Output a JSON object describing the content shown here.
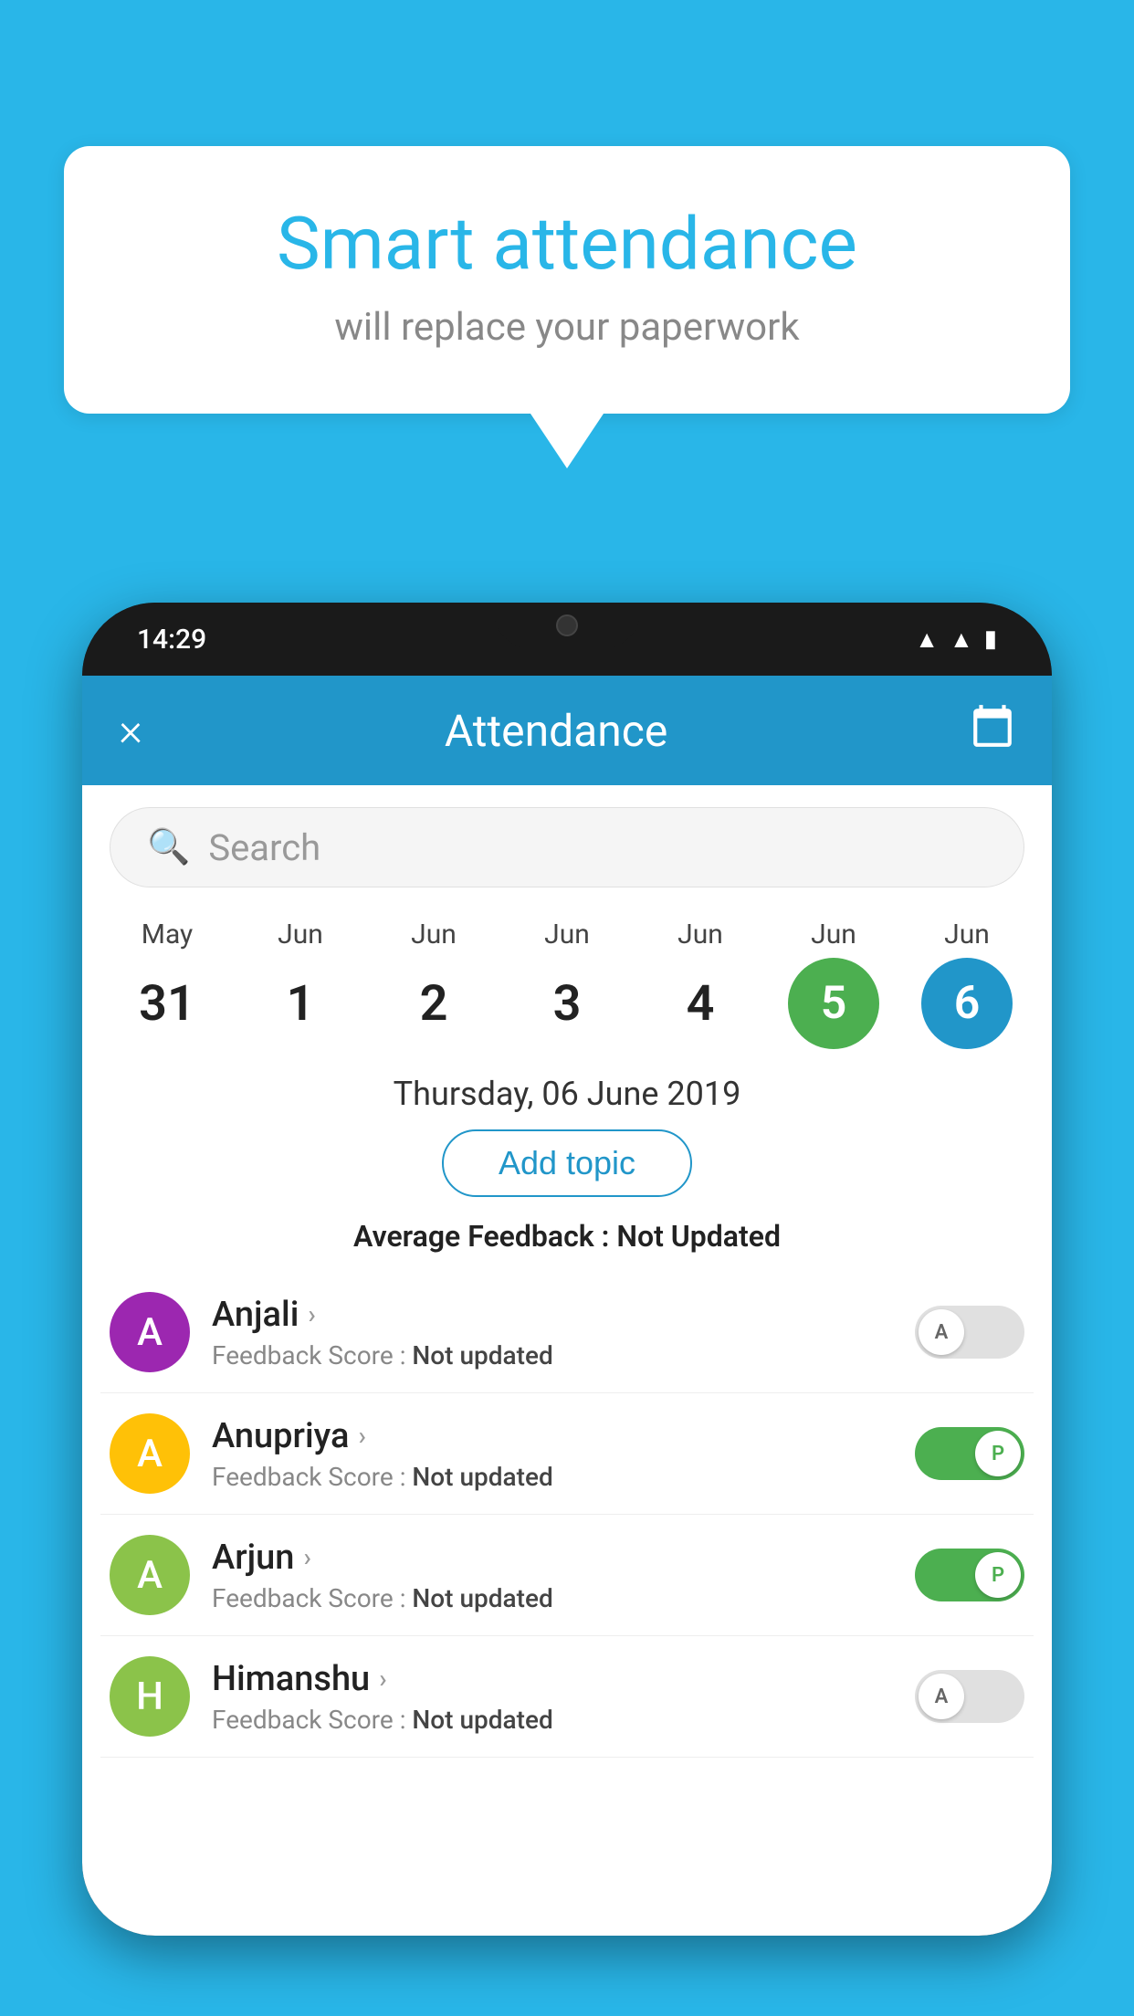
{
  "background": "#29B6E8",
  "bubble": {
    "title": "Smart attendance",
    "subtitle": "will replace your paperwork"
  },
  "phone": {
    "time": "14:29",
    "header": {
      "title": "Attendance",
      "close_label": "×",
      "calendar_icon": "📅"
    },
    "search": {
      "placeholder": "Search"
    },
    "calendar": {
      "days": [
        {
          "month": "May",
          "day": "31",
          "state": "normal"
        },
        {
          "month": "Jun",
          "day": "1",
          "state": "normal"
        },
        {
          "month": "Jun",
          "day": "2",
          "state": "normal"
        },
        {
          "month": "Jun",
          "day": "3",
          "state": "normal"
        },
        {
          "month": "Jun",
          "day": "4",
          "state": "normal"
        },
        {
          "month": "Jun",
          "day": "5",
          "state": "today"
        },
        {
          "month": "Jun",
          "day": "6",
          "state": "selected"
        }
      ]
    },
    "selected_date": "Thursday, 06 June 2019",
    "add_topic_label": "Add topic",
    "avg_feedback_label": "Average Feedback : ",
    "avg_feedback_value": "Not Updated",
    "students": [
      {
        "name": "Anjali",
        "avatar_letter": "A",
        "avatar_color": "#9C27B0",
        "feedback_label": "Feedback Score : ",
        "feedback_value": "Not updated",
        "toggle_state": "off",
        "toggle_label": "A"
      },
      {
        "name": "Anupriya",
        "avatar_letter": "A",
        "avatar_color": "#FFC107",
        "feedback_label": "Feedback Score : ",
        "feedback_value": "Not updated",
        "toggle_state": "on",
        "toggle_label": "P"
      },
      {
        "name": "Arjun",
        "avatar_letter": "A",
        "avatar_color": "#8BC34A",
        "feedback_label": "Feedback Score : ",
        "feedback_value": "Not updated",
        "toggle_state": "on",
        "toggle_label": "P"
      },
      {
        "name": "Himanshu",
        "avatar_letter": "H",
        "avatar_color": "#8BC34A",
        "feedback_label": "Feedback Score : ",
        "feedback_value": "Not updated",
        "toggle_state": "off",
        "toggle_label": "A"
      }
    ]
  }
}
